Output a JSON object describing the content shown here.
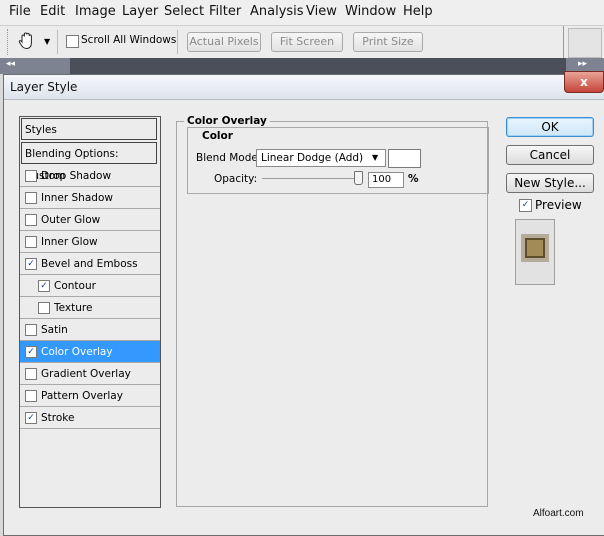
{
  "menubar": {
    "items": [
      "File",
      "Edit",
      "Image",
      "Layer",
      "Select",
      "Filter",
      "Analysis",
      "View",
      "Window",
      "Help"
    ]
  },
  "toolbar": {
    "tool_icon": "hand-icon",
    "scroll_all_windows": "Scroll All Windows",
    "actual_pixels": "Actual Pixels",
    "fit_screen": "Fit Screen",
    "print_size": "Print Size"
  },
  "dialog": {
    "title": "Layer Style",
    "close": "x",
    "styles_list": {
      "header": "Styles",
      "blending": "Blending Options: Custom",
      "items": [
        {
          "label": "Drop Shadow",
          "checked": false
        },
        {
          "label": "Inner Shadow",
          "checked": false
        },
        {
          "label": "Outer Glow",
          "checked": false
        },
        {
          "label": "Inner Glow",
          "checked": false
        },
        {
          "label": "Bevel and Emboss",
          "checked": true
        },
        {
          "label": "Contour",
          "checked": true
        },
        {
          "label": "Texture",
          "checked": false
        },
        {
          "label": "Satin",
          "checked": false
        },
        {
          "label": "Color Overlay",
          "checked": true
        },
        {
          "label": "Gradient Overlay",
          "checked": false
        },
        {
          "label": "Pattern Overlay",
          "checked": false
        },
        {
          "label": "Stroke",
          "checked": true
        }
      ]
    },
    "panel": {
      "title": "Color Overlay",
      "group": "Color",
      "blend_mode_label": "Blend Mode:",
      "blend_mode_value": "Linear Dodge (Add)",
      "opacity_label": "Opacity:",
      "opacity_value": "100",
      "opacity_unit": "%",
      "opacity_level": 1.0
    },
    "buttons": {
      "ok": "OK",
      "cancel": "Cancel",
      "new_style": "New Style...",
      "preview": "Preview"
    }
  },
  "watermark": "Alfoart.com"
}
